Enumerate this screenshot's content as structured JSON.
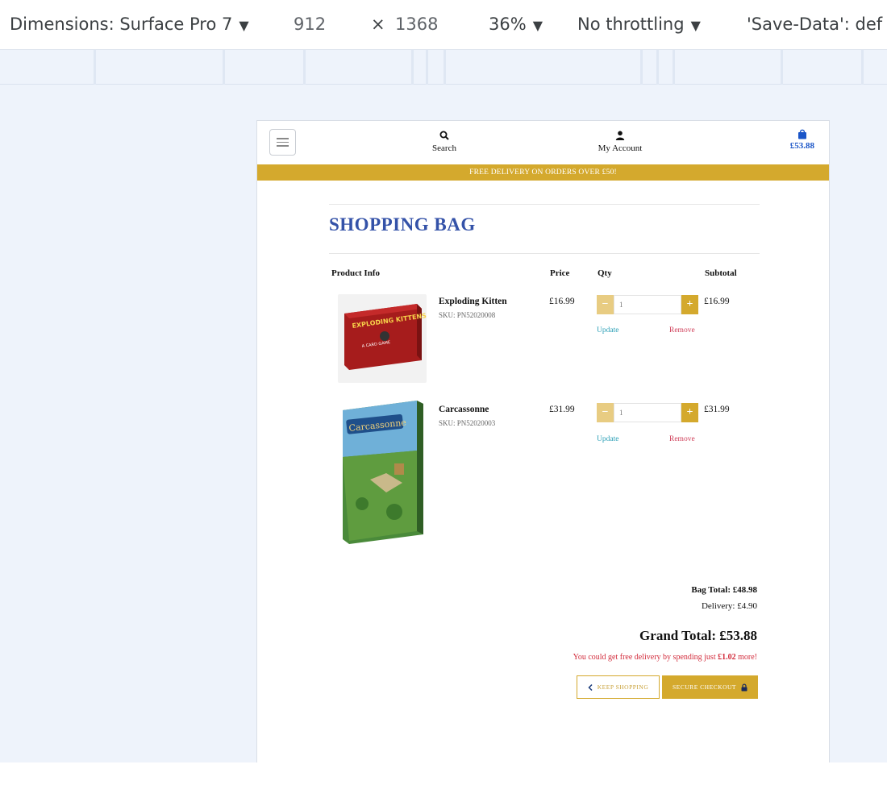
{
  "devtools": {
    "dimensions_label": "Dimensions: Surface Pro 7",
    "width": "912",
    "times": "×",
    "height": "1368",
    "zoom": "36%",
    "throttling": "No throttling",
    "save_data": "'Save-Data': def"
  },
  "header": {
    "search_label": "Search",
    "account_label": "My Account",
    "cart_total": "£53.88",
    "banner": "FREE DELIVERY ON ORDERS OVER £50!"
  },
  "bag": {
    "title": "SHOPPING BAG",
    "columns": {
      "product": "Product Info",
      "price": "Price",
      "qty": "Qty",
      "subtotal": "Subtotal"
    },
    "items": [
      {
        "name": "Exploding Kitten",
        "sku": "SKU: PN52020008",
        "price": "£16.99",
        "qty": "1",
        "subtotal": "£16.99",
        "update": "Update",
        "remove": "Remove",
        "box_title": "EXPLODING KITTENS",
        "box_sub": "A CARD GAME"
      },
      {
        "name": "Carcassonne",
        "sku": "SKU: PN52020003",
        "price": "£31.99",
        "qty": "1",
        "subtotal": "£31.99",
        "update": "Update",
        "remove": "Remove",
        "box_title": "Carcassonne"
      }
    ],
    "bag_total": "Bag Total: £48.98",
    "delivery": "Delivery: £4.90",
    "grand_total": "Grand Total: £53.88",
    "free_hint_prefix": "You could get free delivery by spending just ",
    "free_hint_amount": "£1.02",
    "free_hint_suffix": " more!",
    "keep_shopping": "KEEP SHOPPING",
    "secure_checkout": "SECURE CHECKOUT"
  },
  "colors": {
    "accent": "#d4a92d",
    "title_blue": "#3452a8",
    "link_teal": "#2a9fb6",
    "link_red": "#d0405a"
  },
  "icons": [
    "search-icon",
    "user-icon",
    "shopping-bag-icon",
    "hamburger-icon",
    "chevron-left-icon",
    "lock-icon"
  ]
}
